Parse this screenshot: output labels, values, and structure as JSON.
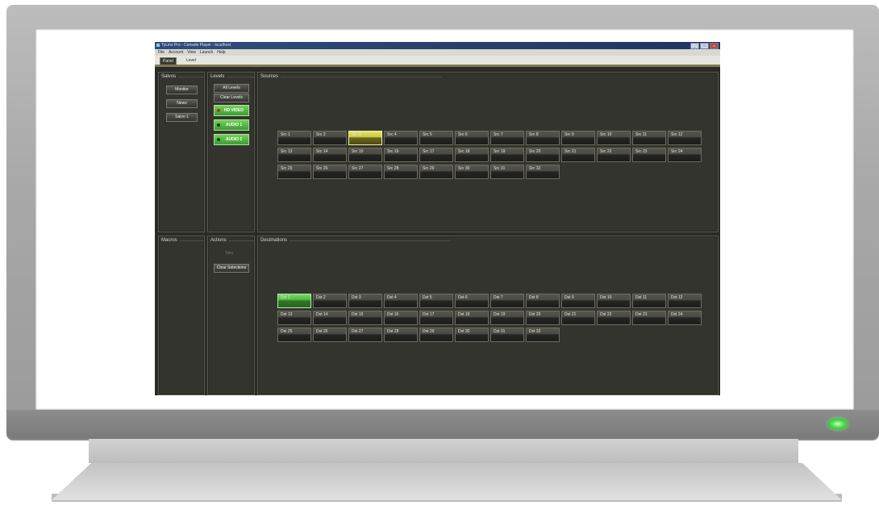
{
  "window": {
    "title": "TyLinx Pro - Console Player - localhost",
    "controls": [
      "_",
      "□",
      "x"
    ]
  },
  "menu": [
    "File",
    "Account",
    "View",
    "Launch",
    "Help"
  ],
  "tabs": [
    {
      "label": "Panel",
      "active": true
    },
    {
      "label": "Level",
      "active": false
    }
  ],
  "salvos": {
    "title": "Salvos",
    "buttons": [
      "Monitor",
      "News",
      "Salvo 1"
    ]
  },
  "levels": {
    "title": "Levels",
    "all_levels": "All Levels",
    "clear_levels": "Clear Levels",
    "items": [
      {
        "label": "HD VIDEO",
        "indicator": "red"
      },
      {
        "label": "AUDIO 1",
        "indicator": "dark"
      },
      {
        "label": "AUDIO 2",
        "indicator": "dark"
      }
    ]
  },
  "sources": {
    "title": "Sources",
    "items": [
      "Src 1",
      "Src 2",
      "Src 3",
      "Src 4",
      "Src 5",
      "Src 6",
      "Src 7",
      "Src 8",
      "Src 9",
      "Src 10",
      "Src 11",
      "Src 12",
      "Src 13",
      "Src 14",
      "Src 15",
      "Src 16",
      "Src 17",
      "Src 18",
      "Src 19",
      "Src 20",
      "Src 21",
      "Src 22",
      "Src 23",
      "Src 24",
      "Src 25",
      "Src 26",
      "Src 27",
      "Src 28",
      "Src 29",
      "Src 30",
      "Src 31",
      "Src 32"
    ],
    "highlighted_index": 2
  },
  "macros": {
    "title": "Macros"
  },
  "actions": {
    "title": "Actions",
    "take": "Take",
    "clear_selections": "Clear Selections"
  },
  "destinations": {
    "title": "Destinations",
    "items": [
      "Dst 1",
      "Dst 2",
      "Dst 3",
      "Dst 4",
      "Dst 5",
      "Dst 6",
      "Dst 7",
      "Dst 8",
      "Dst 9",
      "Dst 10",
      "Dst 11",
      "Dst 12",
      "Dst 13",
      "Dst 14",
      "Dst 15",
      "Dst 16",
      "Dst 17",
      "Dst 18",
      "Dst 19",
      "Dst 20",
      "Dst 21",
      "Dst 22",
      "Dst 23",
      "Dst 24",
      "Dst 25",
      "Dst 26",
      "Dst 27",
      "Dst 28",
      "Dst 29",
      "Dst 30",
      "Dst 31",
      "Dst 32"
    ],
    "selected_index": 0
  },
  "colors": {
    "selected_source": "#c9c53a",
    "selected_destination": "#4fb13d",
    "level_active": "#4f9f3f",
    "panel_bg": "#34342e",
    "power_led": "#4fe04f"
  }
}
